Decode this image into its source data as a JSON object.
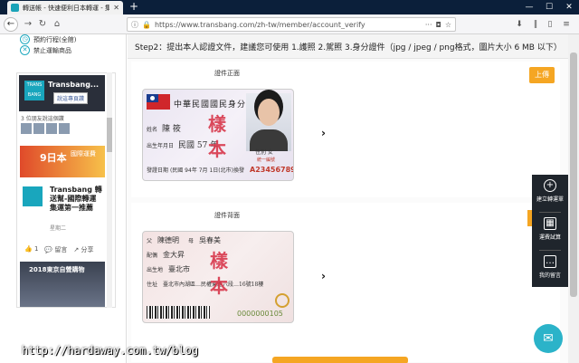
{
  "browser": {
    "tab_title": "轉送帳 - 快速便利日本轉運 - 集運",
    "tab_close": "✕",
    "new_tab": "+",
    "win_min": "—",
    "win_max": "☐",
    "win_close": "✕",
    "url": "https://www.transbang.com/zh-tw/member/account_verify",
    "back": "←",
    "forward": "→",
    "reload": "↻",
    "home": "⌂",
    "more": "···"
  },
  "left_panel": {
    "row1": "預約行程(全館)",
    "row2": "禁止運輸商品",
    "fb": {
      "page_name": "Transbang...",
      "like_label": "說這專頁讚",
      "logo_text": "TRANS BANG",
      "likes": "3 位朋友說這個讚",
      "post_big": "9日本",
      "post_sub": "國際運費",
      "post_title": "Transbang 轉送幫-國際轉運集運第一推薦",
      "post_time": "星期二",
      "like_count": "1",
      "comment": "留言",
      "share": "分享",
      "img3_text": "2018東京自營購物"
    }
  },
  "main": {
    "step_text": "Step2：提出本人認證文件，建議您可使用 1.護照 2.駕照 3.身分證件（jpg / jpeg / png格式，圖片大小 6 MB 以下）",
    "front_label": "證件正面",
    "back_label": "證件背面",
    "upload_label": "上傳",
    "front_card": {
      "heading": "中華民國國民身分證",
      "name_label": "姓名",
      "name_value": "陳 筱",
      "birth_label": "出生年月日",
      "birth_value": "民國 57 年",
      "issue_label": "發證日期",
      "issue_value": "(民國 94年 7月 1日(北市)換發",
      "gender": "性別 女",
      "id_number_label": "統一編號",
      "id_number": "A234567890",
      "sample_top": "樣",
      "sample_bottom": "本"
    },
    "back_card": {
      "father_label": "父",
      "father_value": "陳德明",
      "mother_label": "母",
      "mother_value": "吳春美",
      "spouse_label": "配偶",
      "spouse_value": "金大昇",
      "birthplace_label": "出生地",
      "birthplace_value": "臺北市",
      "address_label": "住址",
      "address_value": "臺北市內湖區…民權東路六段…16號18樓",
      "serial": "0000000105",
      "sample_top": "樣",
      "sample_bottom": "本"
    },
    "chevron": "›"
  },
  "float_toolbar": {
    "item1_label": "建立轉運單",
    "item2_label": "運費試算",
    "item3_label": "我的留言"
  },
  "watermark": "http://hardaway.com.tw/blog",
  "colors": {
    "accent_orange": "#f5a623",
    "brand_teal": "#19a6bd",
    "sample_red": "#d8374b",
    "chrome_dark": "#0b1f3a"
  }
}
